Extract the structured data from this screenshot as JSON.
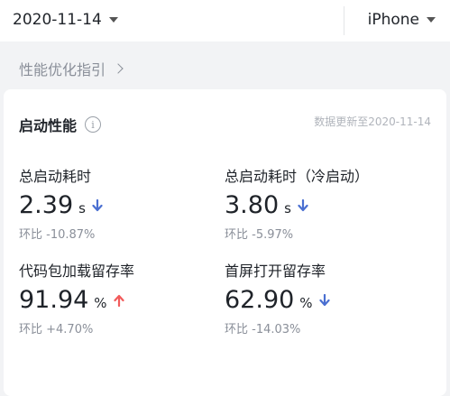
{
  "header": {
    "date": "2020-11-14",
    "device": "iPhone"
  },
  "guide": {
    "label": "性能优化指引"
  },
  "card": {
    "title": "启动性能",
    "info_icon": "i",
    "updated": "数据更新至2020-11-14",
    "metrics": [
      {
        "label": "总启动耗时",
        "value": "2.39",
        "unit": "s",
        "trend": "down",
        "compare": "环比 -10.87%"
      },
      {
        "label": "总启动耗时（冷启动）",
        "value": "3.80",
        "unit": "s",
        "trend": "down",
        "compare": "环比 -5.97%"
      },
      {
        "label": "代码包加载留存率",
        "value": "91.94",
        "unit": "%",
        "trend": "up",
        "compare": "环比 +4.70%"
      },
      {
        "label": "首屏打开留存率",
        "value": "62.90",
        "unit": "%",
        "trend": "down",
        "compare": "环比 -14.03%"
      }
    ]
  },
  "colors": {
    "down_arrow": "#4a6fd1",
    "up_arrow": "#f25b5b",
    "background": "#f2f3f5"
  }
}
